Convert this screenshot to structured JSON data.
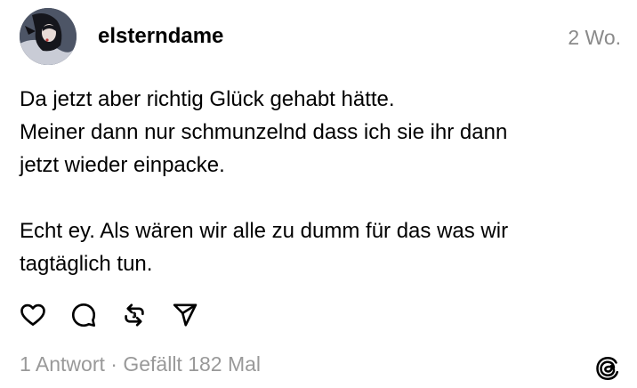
{
  "post": {
    "username": "elsterndame",
    "timestamp": "2 Wo.",
    "paragraphs": [
      "Da jetzt aber richtig Glück gehabt hätte.\nMeiner dann nur schmunzelnd dass ich sie ihr dann\njetzt wieder einpacke.",
      "Echt ey. Als wären wir alle zu dumm für das was wir\ntagtäglich tun."
    ],
    "stats": {
      "replies": "1 Antwort",
      "separator": " · ",
      "likes": "Gefällt 182 Mal"
    }
  },
  "icons": {
    "like": "heart-icon",
    "reply": "comment-icon",
    "repost": "repost-icon",
    "share": "send-icon",
    "brand": "threads-logo-icon"
  },
  "colors": {
    "text": "#000000",
    "muted": "#8a8a8a",
    "background": "#ffffff"
  }
}
